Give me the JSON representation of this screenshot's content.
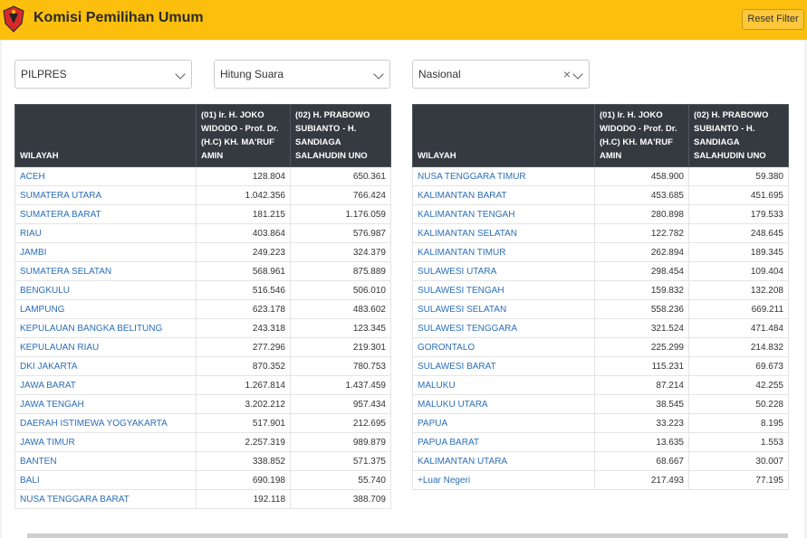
{
  "header": {
    "title": "Komisi Pemilihan Umum",
    "reset_label": "Reset Filter"
  },
  "colors": {
    "header": "#fcbf0e",
    "table_header": "#343a40",
    "link": "#2c6fb8"
  },
  "filters": [
    {
      "value": "PILPRES"
    },
    {
      "value": "Hitung Suara"
    },
    {
      "value": "Nasional"
    }
  ],
  "table": {
    "col_wilayah": "WILAYAH",
    "col_01": "(01) Ir. H. JOKO WIDODO - Prof. Dr. (H.C) KH. MA'RUF AMIN",
    "col_02": "(02) H. PRABOWO SUBIANTO - H. SANDIAGA SALAHUDIN UNO",
    "left_rows": [
      [
        "ACEH",
        "128.804",
        "650.361"
      ],
      [
        "SUMATERA UTARA",
        "1.042.356",
        "766.424"
      ],
      [
        "SUMATERA BARAT",
        "181.215",
        "1.176.059"
      ],
      [
        "RIAU",
        "403.864",
        "576.987"
      ],
      [
        "JAMBI",
        "249.223",
        "324.379"
      ],
      [
        "SUMATERA SELATAN",
        "568.961",
        "875.889"
      ],
      [
        "BENGKULU",
        "516.546",
        "506.010"
      ],
      [
        "LAMPUNG",
        "623.178",
        "483.602"
      ],
      [
        "KEPULAUAN BANGKA BELITUNG",
        "243.318",
        "123.345"
      ],
      [
        "KEPULAUAN RIAU",
        "277.296",
        "219.301"
      ],
      [
        "DKI JAKARTA",
        "870.352",
        "780.753"
      ],
      [
        "JAWA BARAT",
        "1.267.814",
        "1.437.459"
      ],
      [
        "JAWA TENGAH",
        "3.202.212",
        "957.434"
      ],
      [
        "DAERAH ISTIMEWA YOGYAKARTA",
        "517.901",
        "212.695"
      ],
      [
        "JAWA TIMUR",
        "2.257.319",
        "989.879"
      ],
      [
        "BANTEN",
        "338.852",
        "571.375"
      ],
      [
        "BALI",
        "690.198",
        "55.740"
      ],
      [
        "NUSA TENGGARA BARAT",
        "192.118",
        "388.709"
      ]
    ],
    "right_rows": [
      [
        "NUSA TENGGARA TIMUR",
        "458.900",
        "59.380"
      ],
      [
        "KALIMANTAN BARAT",
        "453.685",
        "451.695"
      ],
      [
        "KALIMANTAN TENGAH",
        "280.898",
        "179.533"
      ],
      [
        "KALIMANTAN SELATAN",
        "122.782",
        "248.645"
      ],
      [
        "KALIMANTAN TIMUR",
        "262.894",
        "189.345"
      ],
      [
        "SULAWESI UTARA",
        "298.454",
        "109.404"
      ],
      [
        "SULAWESI TENGAH",
        "159.832",
        "132.208"
      ],
      [
        "SULAWESI SELATAN",
        "558.236",
        "669.211"
      ],
      [
        "SULAWESI TENGGARA",
        "321.524",
        "471.484"
      ],
      [
        "GORONTALO",
        "225.299",
        "214.832"
      ],
      [
        "SULAWESI BARAT",
        "115.231",
        "69.673"
      ],
      [
        "MALUKU",
        "87.214",
        "42.255"
      ],
      [
        "MALUKU UTARA",
        "38.545",
        "50.228"
      ],
      [
        "PAPUA",
        "33.223",
        "8.195"
      ],
      [
        "PAPUA BARAT",
        "13.635",
        "1.553"
      ],
      [
        "KALIMANTAN UTARA",
        "68.667",
        "30.007"
      ],
      [
        "+Luar Negeri",
        "217.493",
        "77.195"
      ]
    ]
  }
}
